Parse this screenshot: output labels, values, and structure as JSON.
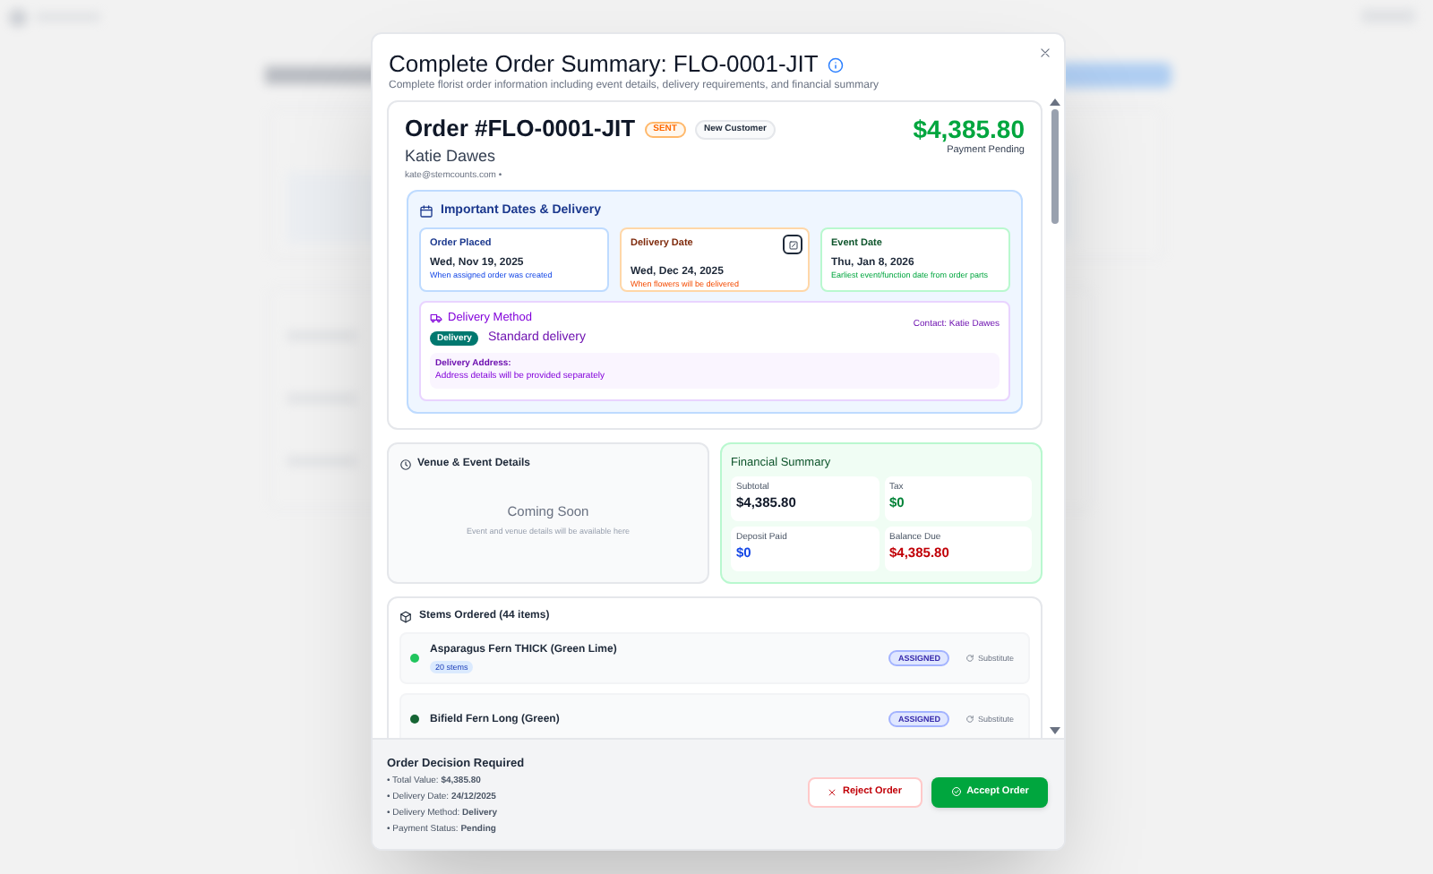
{
  "dialog": {
    "title": "Complete Order Summary: FLO-0001-JIT",
    "subtitle": "Complete florist order information including event details, delivery requirements, and financial summary"
  },
  "order": {
    "number": "Order #FLO-0001-JIT",
    "status": "SENT",
    "customer_tag": "New Customer",
    "customer_name": "Katie Dawes",
    "email": "kate@stemcounts.com •",
    "total": "$4,385.80",
    "payment_status": "Payment Pending"
  },
  "dates": {
    "title": "Important Dates & Delivery",
    "cards": [
      {
        "kind": "placed",
        "label": "Order Placed",
        "date": "Wed, Nov 19, 2025",
        "note": "When assigned order was created",
        "editable": false
      },
      {
        "kind": "delivery",
        "label": "Delivery Date",
        "date": "Wed, Dec 24, 2025",
        "note": "When flowers will be delivered",
        "editable": true
      },
      {
        "kind": "event",
        "label": "Event Date",
        "date": "Thu, Jan 8, 2026",
        "note": "Earliest event/function date from order parts",
        "editable": false
      }
    ]
  },
  "delivery": {
    "title": "Delivery Method",
    "badge": "Delivery",
    "method": "Standard delivery",
    "contact": "Contact: Katie Dawes",
    "address_label": "Delivery Address:",
    "address": "Address details will be provided separately"
  },
  "venue": {
    "title": "Venue & Event Details",
    "heading": "Coming Soon",
    "text": "Event and venue details will be available here"
  },
  "financial": {
    "title": "Financial Summary",
    "items": [
      {
        "kind": "neutral",
        "label": "Subtotal",
        "value": "$4,385.80"
      },
      {
        "kind": "positive",
        "label": "Tax",
        "value": "$0"
      },
      {
        "kind": "paid",
        "label": "Deposit Paid",
        "value": "$0"
      },
      {
        "kind": "due",
        "label": "Balance Due",
        "value": "$4,385.80"
      }
    ]
  },
  "stems": {
    "title": "Stems Ordered (44 items)",
    "items": [
      {
        "name": "Asparagus Fern THICK (Green Lime)",
        "quantity": "20 stems",
        "status": "ASSIGNED",
        "action": "Substitute",
        "color": "#22c55e"
      },
      {
        "name": "Bifield Fern Long (Green)",
        "status": "ASSIGNED",
        "action": "Substitute",
        "color": "#166534"
      }
    ]
  },
  "decision": {
    "title": "Order Decision Required",
    "lines": [
      "• Total Value: **$4,385.80**",
      "• Delivery Date: **24/12/2025**",
      "• Delivery Method: **Delivery**",
      "• Payment Status: **Pending**"
    ],
    "reject": "Reject Order",
    "accept": "Accept Order"
  }
}
